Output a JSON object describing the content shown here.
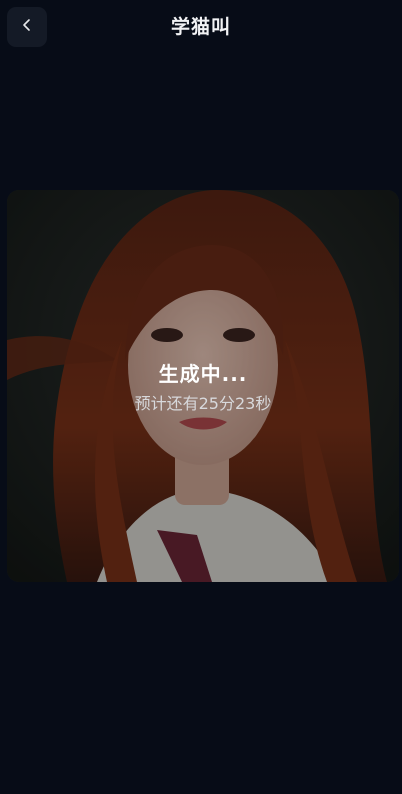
{
  "header": {
    "title": "学猫叫",
    "back_icon": "chevron-left-icon"
  },
  "preview": {
    "status": "生成中...",
    "eta": "预计还有25分23秒"
  },
  "colors": {
    "background": "#070c17",
    "back_button_bg": "#141a26",
    "text_primary": "#ffffff",
    "text_secondary": "#d8d9dc"
  }
}
